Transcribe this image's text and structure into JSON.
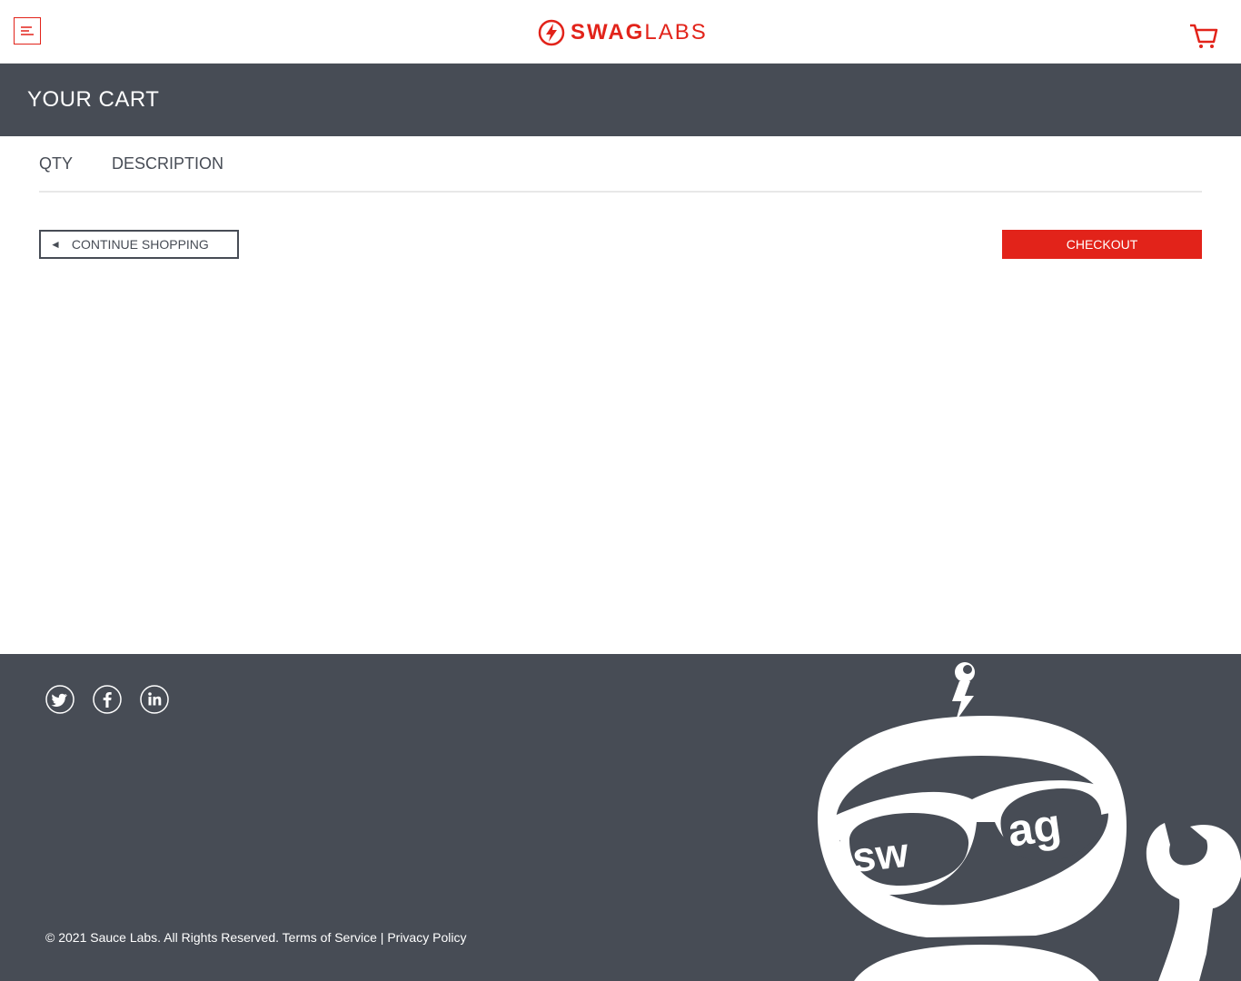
{
  "header": {
    "logo_swag": "SWAG",
    "logo_labs": "LABS",
    "menu_icon": "menu-icon",
    "cart_icon": "cart-icon"
  },
  "subheader": {
    "title": "YOUR CART"
  },
  "cart": {
    "qty_label": "QTY",
    "description_label": "DESCRIPTION",
    "continue_arrow": "◄",
    "continue_label": "CONTINUE SHOPPING",
    "checkout_label": "CHECKOUT"
  },
  "footer": {
    "social": [
      "twitter-icon",
      "facebook-icon",
      "linkedin-icon"
    ],
    "copyright": "© 2021 Sauce Labs. All Rights Reserved. Terms of Service | Privacy Policy"
  },
  "colors": {
    "accent": "#e2231a",
    "dark": "#474c55",
    "background": "#ffffff"
  }
}
